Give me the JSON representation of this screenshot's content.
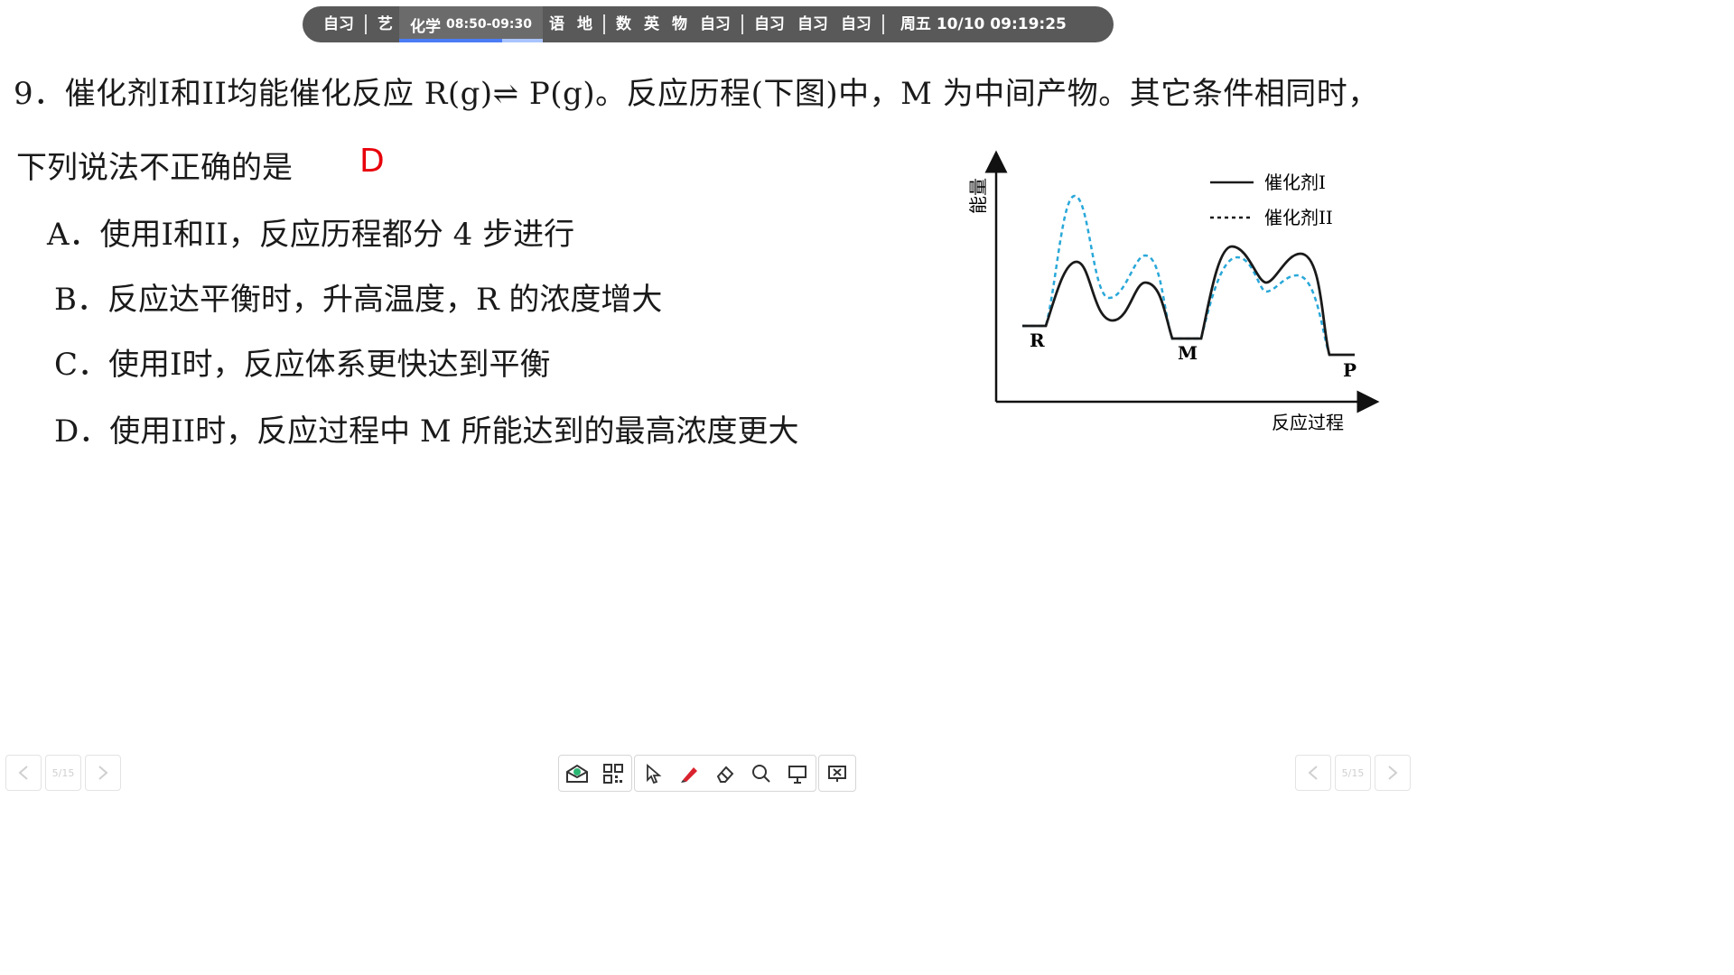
{
  "topbar": {
    "slots_before": [
      "自习",
      "艺"
    ],
    "current": {
      "subject": "化学",
      "time": "08:50-09:30",
      "progress": 0.72
    },
    "slots_mid": [
      "语",
      "地"
    ],
    "slots_mid2": [
      "数",
      "英",
      "物",
      "自习"
    ],
    "slots_after": [
      "自习",
      "自习",
      "自习"
    ],
    "clock": "周五 10/10  09:19:25"
  },
  "question": {
    "line1": "9．催化剂I和II均能催化反应 R(g)⇌ P(g)。反应历程(下图)中，M 为中间产物。其它条件相同时，",
    "line2": "下列说法不正确的是",
    "answer": "D",
    "options": [
      "A．使用I和II，反应历程都分 4 步进行",
      "B．反应达平衡时，升高温度，R 的浓度增大",
      "C．使用I时，反应体系更快达到平衡",
      "D．使用II时，反应过程中 M 所能达到的最高浓度更大"
    ]
  },
  "chart_data": {
    "type": "line",
    "ylabel": "能量",
    "xlabel": "反应过程",
    "point_labels": [
      "R",
      "M",
      "P"
    ],
    "series": [
      {
        "name": "催化剂I",
        "style": "solid",
        "color": "#1a1a1a"
      },
      {
        "name": "催化剂II",
        "style": "dashed",
        "color": "#29a8d9"
      }
    ]
  },
  "nav": {
    "page_left": "5/15",
    "page_right": "5/15"
  },
  "toolbar": {
    "icons": [
      "mail-icon",
      "qr-icon",
      "pointer-icon",
      "pen-icon",
      "eraser-icon",
      "search-icon",
      "presentation-icon",
      "close-screen-icon"
    ]
  }
}
